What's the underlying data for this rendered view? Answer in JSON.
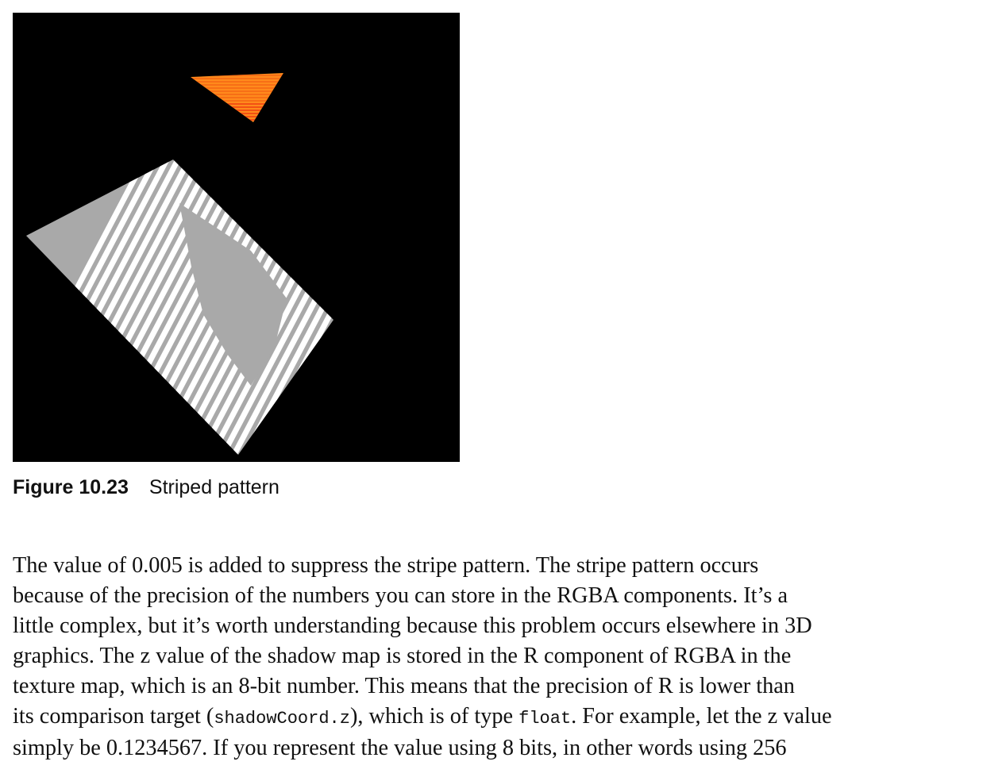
{
  "figure": {
    "number": "Figure 10.23",
    "caption": "Striped pattern",
    "background_color": "#000000",
    "triangle_colors": [
      "#ff8a1c",
      "#f15a12",
      "#e9230f"
    ],
    "plane_colors": [
      "#ffffff",
      "#a9a9a9"
    ]
  },
  "paragraph": {
    "lines": [
      {
        "text": "The value of 0.005 is added to suppress the stripe pattern. The stripe pattern occurs"
      },
      {
        "text": "because of the precision of the numbers you can store in the RGBA components. It’s a"
      },
      {
        "text": "little complex, but it’s worth understanding because this problem occurs elsewhere in 3D"
      },
      {
        "text": "graphics. The z value of the shadow map is stored in the R component of RGBA in the"
      },
      {
        "text": "texture map, which is an 8-bit number. This means that the precision of R is lower than"
      },
      {
        "pre": "its comparison target (",
        "code1": "shadowCoord.z",
        "mid": "), which is of type ",
        "code2": "float",
        "post": ". For example, let the z value"
      },
      {
        "text": "simply be 0.1234567. If you represent the value using 8 bits, in other words using 256"
      }
    ]
  }
}
